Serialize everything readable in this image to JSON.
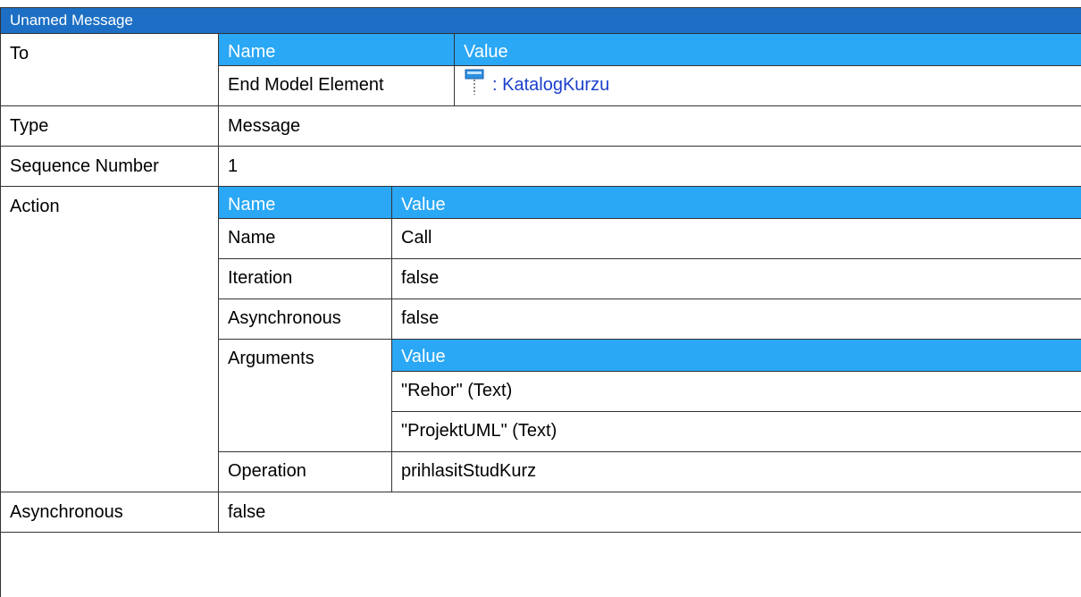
{
  "header": {
    "title": "Unamed Message"
  },
  "to": {
    "label": "To",
    "col_name": "Name",
    "col_value": "Value",
    "rows": [
      {
        "name": "End Model Element",
        "icon": "lifeline-icon",
        "value": ": KatalogKurzu"
      }
    ]
  },
  "type": {
    "label": "Type",
    "value": "Message"
  },
  "sequence": {
    "label": "Sequence Number",
    "value": "1"
  },
  "action": {
    "label": "Action",
    "col_name": "Name",
    "col_value": "Value",
    "name": {
      "key": "Name",
      "value": "Call"
    },
    "iteration": {
      "key": "Iteration",
      "value": "false"
    },
    "asynchronous": {
      "key": "Asynchronous",
      "value": "false"
    },
    "arguments": {
      "key": "Arguments",
      "col_value": "Value",
      "items": [
        "\"Rehor\" (Text)",
        "\"ProjektUML\" (Text)"
      ]
    },
    "operation": {
      "key": "Operation",
      "value": "prihlasitStudKurz"
    }
  },
  "asynchronous": {
    "label": "Asynchronous",
    "value": "false"
  }
}
